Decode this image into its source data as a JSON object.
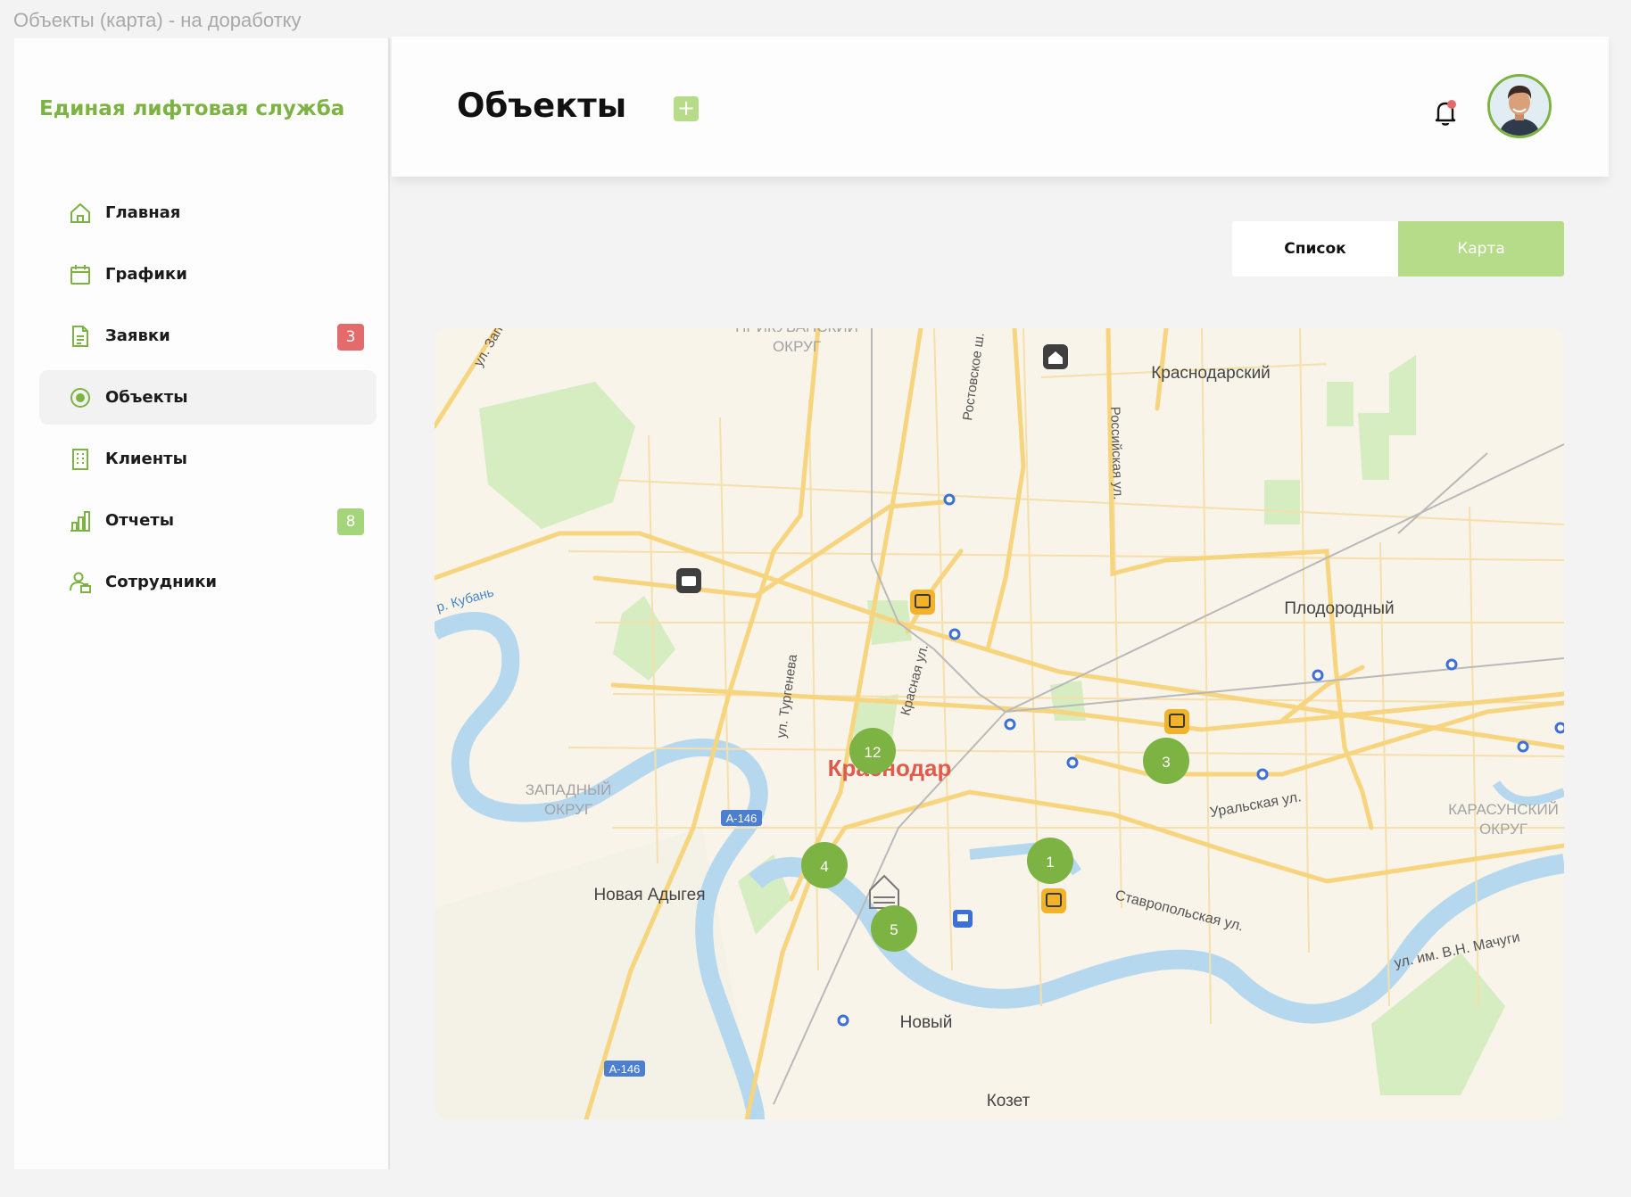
{
  "window_title": "Объекты (карта) - на доработку",
  "brand": "Единая лифтовая служба",
  "nav": [
    {
      "label": "Главная",
      "icon": "home-icon"
    },
    {
      "label": "Графики",
      "icon": "calendar-icon"
    },
    {
      "label": "Заявки",
      "icon": "document-icon",
      "badge": "3",
      "badge_color": "#e46b6b"
    },
    {
      "label": "Объекты",
      "icon": "target-icon",
      "active": true
    },
    {
      "label": "Клиенты",
      "icon": "building-icon"
    },
    {
      "label": "Отчеты",
      "icon": "bar-chart-icon",
      "badge": "8",
      "badge_color": "#a5d57a"
    },
    {
      "label": "Сотрудники",
      "icon": "staff-icon"
    }
  ],
  "header": {
    "title": "Объекты",
    "add_label": "+",
    "notification_dot_color": "#e46b6b"
  },
  "view_toggle": {
    "list_label": "Список",
    "map_label": "Карта",
    "active": "map"
  },
  "map": {
    "city_label": "Краснодар",
    "labels": {
      "prikubansky": "ПРИКУБАНСКИЙ",
      "prikubansky_okrug": "ОКРУГ",
      "krasnodarsky": "Краснодарский",
      "plodorodny": "Плодородный",
      "zapadny": "ЗАПАДНЫЙ",
      "zapadny_okrug": "ОКРУГ",
      "karasunsky": "КАРАСУНСКИЙ",
      "karasunsky_okrug": "ОКРУГ",
      "novaya_adygeya": "Новая Адыгея",
      "novy": "Новый",
      "kozet": "Козет",
      "uralskaya": "Уральская ул.",
      "stavropolskaya": "Ставропольская ул.",
      "machugi": "ул. им. В.Н. Мачуги",
      "turgeneva": "ул. Тургенева",
      "krasnaya": "Красная ул.",
      "rossiyskaya": "Российская ул.",
      "rostovskoe": "Ростовское ш.",
      "zap": "ул. Зап",
      "kuban": "р. Кубань",
      "a146_a": "А-146",
      "a146_b": "А-146"
    },
    "clusters": [
      "12",
      "3",
      "4",
      "1",
      "5"
    ],
    "cluster_color": "#7cb342"
  }
}
